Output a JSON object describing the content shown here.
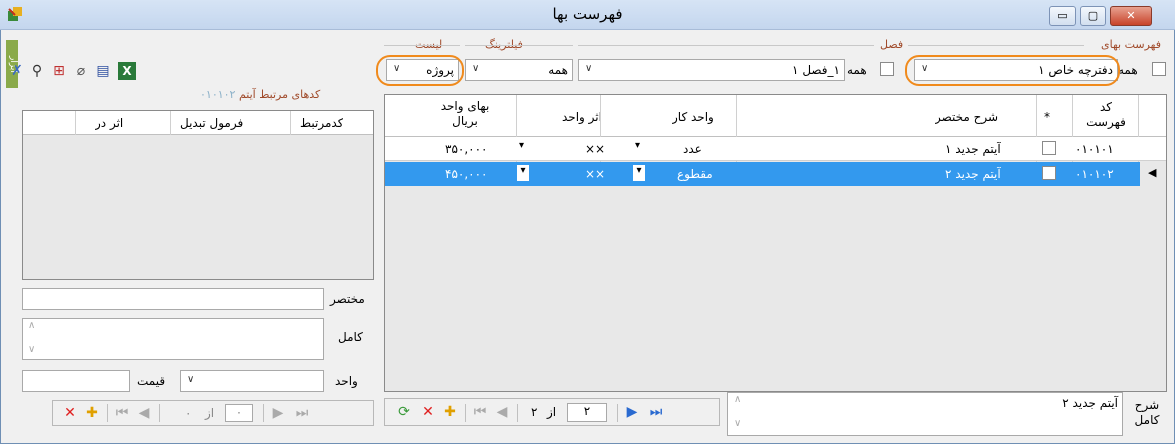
{
  "window": {
    "title": "فهرست بها",
    "minimize_label": "▭",
    "maximize_label": "▢",
    "close_label": "✕"
  },
  "filters": {
    "price_list": {
      "group_label": "فهرست بهای",
      "all_label": "همه",
      "value": "دفترچه خاص ۱"
    },
    "chapter": {
      "group_label": "فصل",
      "all_label": "همه",
      "value": "۱_فصل ۱"
    },
    "filtering": {
      "group_label": "فیلترینگ",
      "value": "همه"
    },
    "list": {
      "group_label": "لیست",
      "value": "پروژه"
    }
  },
  "main_grid": {
    "headers": {
      "code": "کد فهرست",
      "star": "*",
      "desc": "شرح مختصر",
      "unit": "واحد کار",
      "effect": "اثر واحد",
      "price": "بهای واحد بریال"
    },
    "rows": [
      {
        "code": "۰۱۰۱۰۱",
        "desc": "آیتم جدید ۱",
        "unit": "عدد",
        "effect": "××",
        "price": "۳۵۰,۰۰۰"
      },
      {
        "code": "۰۱۰۱۰۲",
        "desc": "آیتم جدید ۲",
        "unit": "مقطوع",
        "effect": "××",
        "price": "۴۵۰,۰۰۰"
      }
    ]
  },
  "main_nav": {
    "current": "۲",
    "of_label": "از",
    "total": "۲"
  },
  "full_desc": {
    "label": "شرح کامل",
    "value": "آیتم جدید ۲"
  },
  "right_panel": {
    "group_label": "کدهای مرتبط آیتم",
    "group_code": "۰۱۰۱۰۲",
    "headers": {
      "code": "کدمرتبط",
      "formula": "فرمول تبدیل",
      "effect": "اثر در"
    },
    "short_label": "مختصر",
    "full_label": "کامل",
    "unit_label": "واحد",
    "price_label": "قیمت",
    "nav": {
      "current": "۰",
      "of_label": "از",
      "total": "۰"
    }
  },
  "side_tab": "ابزار"
}
